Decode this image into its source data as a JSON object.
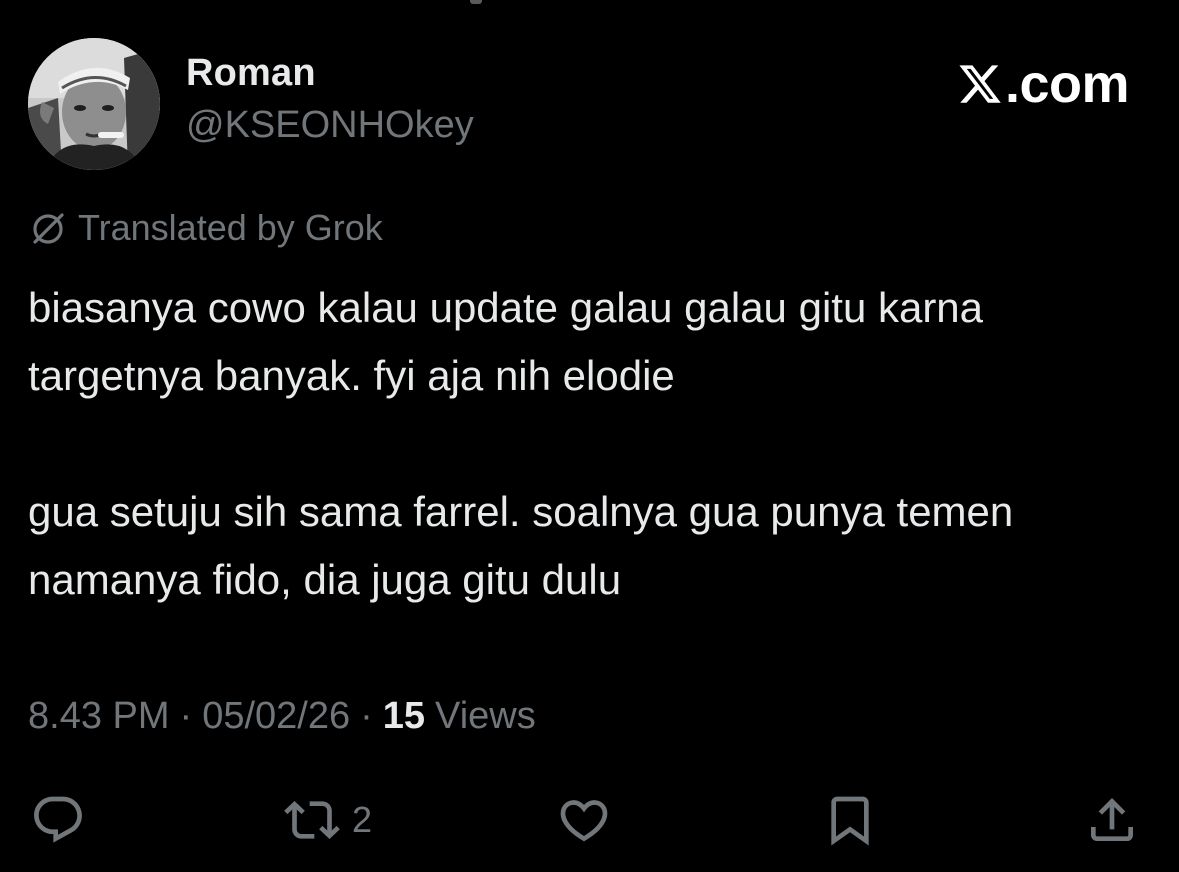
{
  "author": {
    "name": "Roman",
    "handle": "@KSEONHOkey"
  },
  "brand": {
    "label": ".com"
  },
  "translation": {
    "label": "Translated by Grok"
  },
  "tweet": {
    "paragraphs": [
      "biasanya cowo kalau update galau galau gitu karna targetnya banyak. fyi aja nih elodie",
      "gua setuju sih sama farrel. soalnya gua punya temen namanya fido, dia juga gitu dulu"
    ]
  },
  "meta": {
    "time": "8.43 PM",
    "separator": "·",
    "date": "05/02/26",
    "views_count": "15",
    "views_label": "Views"
  },
  "actions": {
    "reply_icon": "reply-icon",
    "repost_icon": "repost-icon",
    "repost_count": "2",
    "like_icon": "heart-icon",
    "bookmark_icon": "bookmark-icon",
    "share_icon": "share-icon"
  },
  "colors": {
    "background": "#000000",
    "primary_text": "#e7e9ea",
    "secondary_text": "#71767b"
  }
}
